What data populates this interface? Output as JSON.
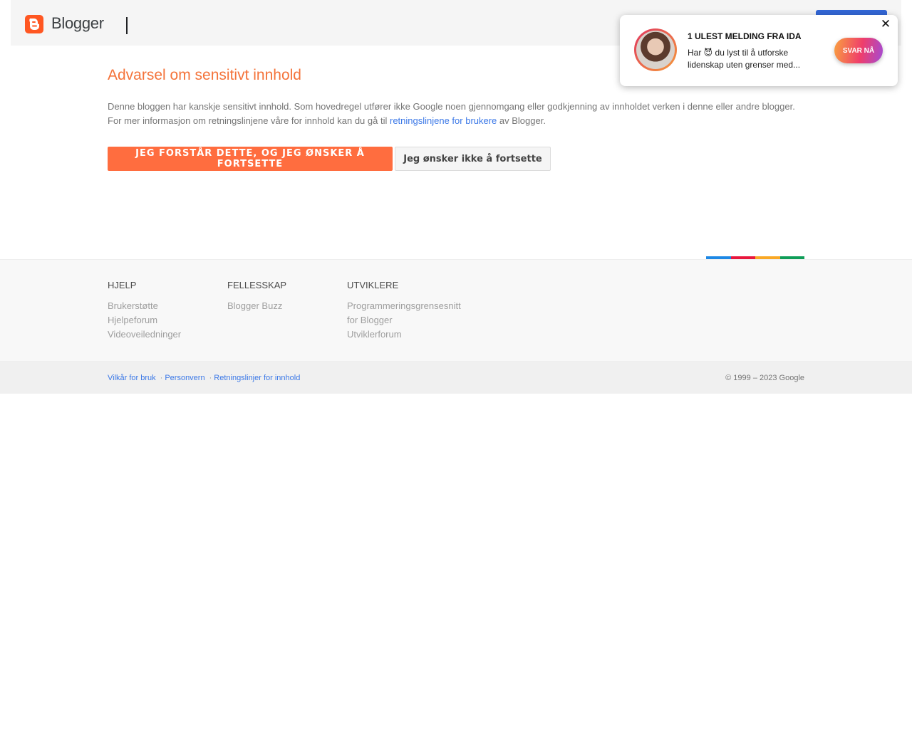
{
  "header": {
    "logo_text": "Blogger"
  },
  "warning": {
    "title": "Advarsel om sensitivt innhold",
    "line1": "Denne bloggen har kanskje sensitivt innhold. Som hovedregel utfører ikke Google noen gjennomgang eller godkjenning av innholdet verken i denne eller andre blogger.",
    "line2_prefix": "For mer informasjon om retningslinjene våre for innhold kan du gå til ",
    "line2_link": "retningslinjene for brukere",
    "line2_suffix": " av Blogger.",
    "continue_label": "Jeg forstår dette, og jeg ønsker å fortsette",
    "decline_label": "Jeg ønsker ikke å fortsette"
  },
  "footer": {
    "columns": [
      {
        "heading": "Hjelp",
        "links": [
          "Brukerstøtte",
          "Hjelpeforum",
          "Videoveiledninger"
        ]
      },
      {
        "heading": "Fellesskap",
        "links": [
          "Blogger Buzz"
        ]
      },
      {
        "heading": "Utviklere",
        "links": [
          "Programmeringsgrensesnitt",
          "for Blogger",
          "Utviklerforum"
        ]
      }
    ],
    "legal": [
      "Vilkår for bruk",
      "Personvern",
      "Retningslinjer for innhold"
    ],
    "copyright": "© 1999 – 2023 Google"
  },
  "popup": {
    "title": "1 ulest melding fra Ida",
    "message": "Har 😈 du lyst til å utforske lidenskap uten grenser med...",
    "button_label": "SVAR NÅ",
    "close_symbol": "✕"
  },
  "colors": {
    "accent_orange": "#f4733a",
    "button_orange": "#ff6d3f",
    "link_blue": "#3b78e7",
    "bar": [
      "#1e88e5",
      "#e8173d",
      "#f9a825",
      "#0f9d58"
    ]
  }
}
